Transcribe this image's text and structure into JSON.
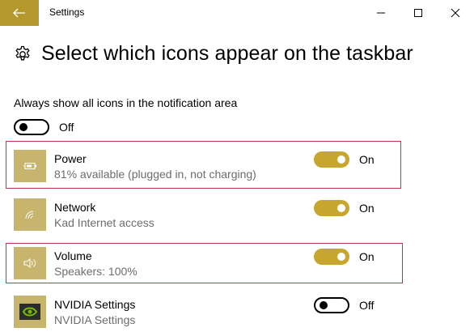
{
  "window": {
    "title": "Settings"
  },
  "header": {
    "title": "Select which icons appear on the taskbar"
  },
  "always_show": {
    "label": "Always show all icons in the notification area",
    "state": "Off",
    "enabled": false
  },
  "items": [
    {
      "name": "Power",
      "subtitle": "81% available (plugged in, not charging)",
      "state": "On",
      "enabled": true,
      "icon": "battery-icon",
      "highlighted": true
    },
    {
      "name": "Network",
      "subtitle": "Kad Internet access",
      "state": "On",
      "enabled": true,
      "icon": "wifi-icon",
      "highlighted": false
    },
    {
      "name": "Volume",
      "subtitle": "Speakers: 100%",
      "state": "On",
      "enabled": true,
      "icon": "speaker-icon",
      "highlighted": true
    },
    {
      "name": "NVIDIA Settings",
      "subtitle": "NVIDIA Settings",
      "state": "Off",
      "enabled": false,
      "icon": "nvidia-icon",
      "highlighted": false
    }
  ],
  "colors": {
    "accent": "#c6a62e",
    "back_button": "#b49a2e",
    "icon_tile": "#c7b46d",
    "highlight_border": "#c0344a"
  }
}
